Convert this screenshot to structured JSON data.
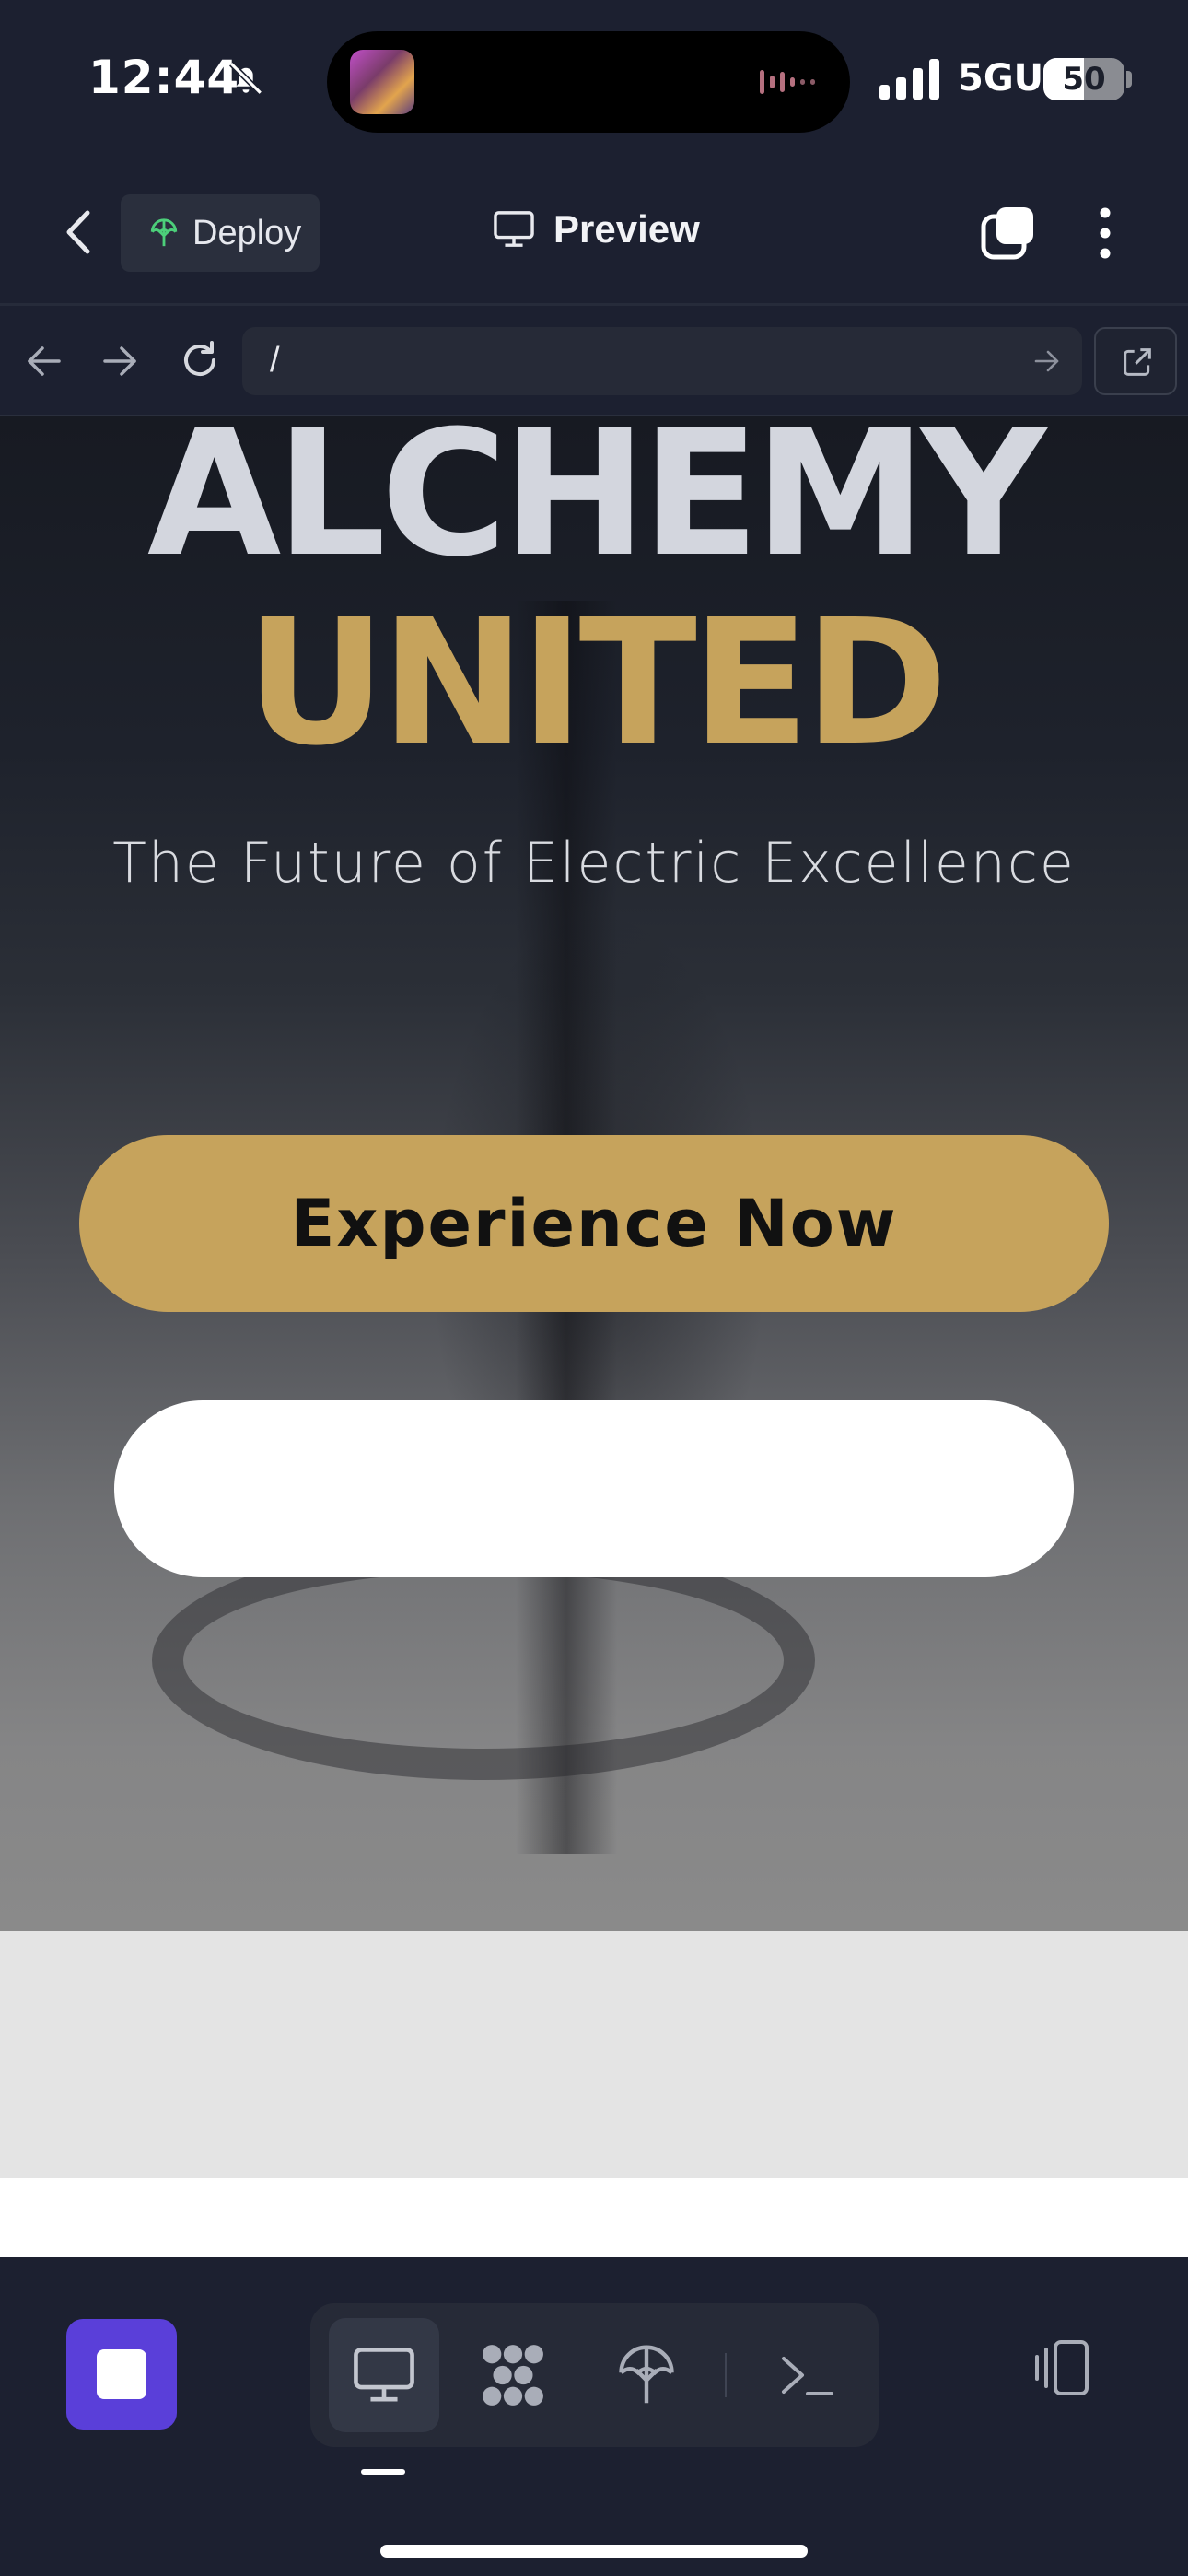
{
  "status_bar": {
    "time": "12:44",
    "network": "5GUC",
    "battery_text": "50",
    "battery_level": 0.5,
    "icons": [
      "bell-slash-icon",
      "cellular-signal-icon",
      "battery-icon"
    ]
  },
  "header": {
    "deploy_label": "Deploy",
    "preview_label": "Preview",
    "icons": [
      "back-chevron-icon",
      "deploy-icon",
      "monitor-icon",
      "tabs-icon",
      "more-vertical-icon"
    ]
  },
  "browser": {
    "url": "/",
    "icons": [
      "arrow-left-icon",
      "arrow-right-icon",
      "reload-icon",
      "go-arrow-icon",
      "external-link-icon"
    ]
  },
  "page": {
    "title_line1": "ALCHEMY",
    "title_line2": "UNITED",
    "subtitle": "The Future of Electric Excellence",
    "cta_primary": "Experience Now",
    "cta_secondary": ""
  },
  "toolbar": {
    "icons": [
      "stop-icon",
      "monitor-icon",
      "workflow-icon",
      "deploy-icon",
      "terminal-icon",
      "panel-toggle-icon"
    ]
  },
  "colors": {
    "accent_gold": "#c6a35c",
    "title_silver": "#d3d6de",
    "stop_purple": "#5a3fd9",
    "deploy_green": "#4ccf7a",
    "chrome_bg": "#1c2030"
  }
}
